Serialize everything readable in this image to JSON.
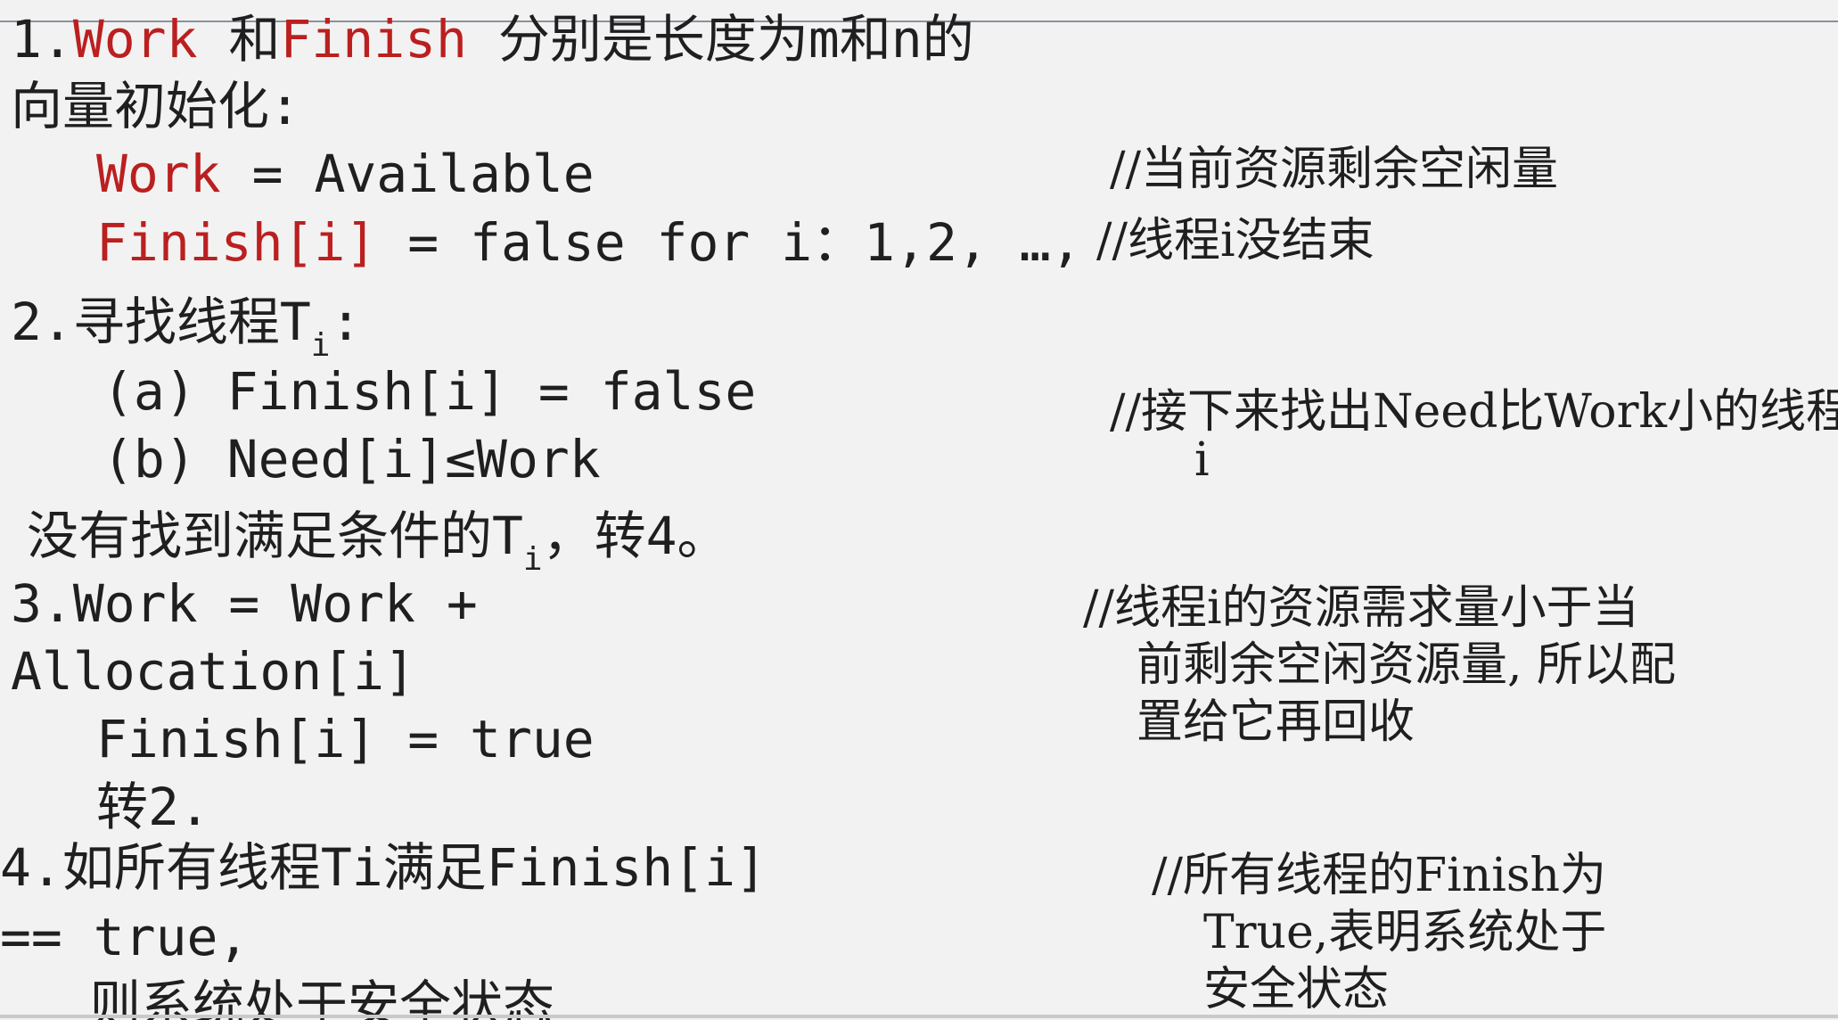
{
  "step1": {
    "num": "1.",
    "work": "Work",
    "he": " 和",
    "finish": "Finish",
    "rest": " 分别是长度为m和n的",
    "line2": "向量初始化:",
    "work_var": "Work",
    "work_assign": " = Available",
    "work_comment": "//当前资源剩余空闲量",
    "finish_var": "Finish[i]",
    "finish_assign": " = false for i：1,2, …,",
    "finish_comment": "//线程i没结束"
  },
  "step2": {
    "num": "2.",
    "title": "寻找线程T",
    "sub": "i",
    "colon": ":",
    "cond_a": "(a) Finish[i] = false",
    "cond_b": "(b) Need[i]≤Work",
    "comment_line1": "//接下来找出Need比Work小的线程",
    "comment_line2": "i",
    "none_found_a": "没有找到满足条件的T",
    "none_found_sub": "i",
    "none_found_b": "，转4。"
  },
  "step3": {
    "line1": "3.Work = Work +",
    "line2": "Allocation[i]",
    "line3": "Finish[i] = true",
    "line4": "转2.",
    "comment_line1": "//线程i的资源需求量小于当",
    "comment_line2": "前剩余空闲资源量, 所以配",
    "comment_line3": "置给它再回收"
  },
  "step4": {
    "line1": "4.如所有线程Ti满足Finish[i]",
    "line2": "== true,",
    "line3": "则系统处于安全状态",
    "comment_line1": "//所有线程的Finish为",
    "comment_line2": "True,表明系统处于",
    "comment_line3": "安全状态"
  }
}
